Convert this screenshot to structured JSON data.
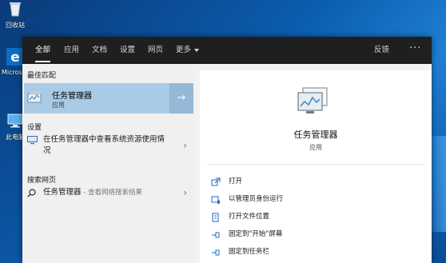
{
  "desktop": {
    "icons": [
      {
        "name": "recycle-bin",
        "label": "回收站"
      },
      {
        "name": "edge",
        "label": "Microsoft Edge"
      },
      {
        "name": "this-pc",
        "label": "此电脑"
      }
    ]
  },
  "search": {
    "tabs": [
      {
        "label": "全部",
        "active": true
      },
      {
        "label": "应用"
      },
      {
        "label": "文档"
      },
      {
        "label": "设置"
      },
      {
        "label": "网页"
      },
      {
        "label": "更多"
      }
    ],
    "feedback": "反馈",
    "more_dots": "···",
    "best_match": {
      "heading": "最佳匹配",
      "title": "任务管理器",
      "subtitle": "应用"
    },
    "settings": {
      "heading": "设置",
      "item": "在任务管理器中查看系统资源使用情况"
    },
    "web": {
      "heading": "搜索网页",
      "query": "任务管理器",
      "suffix": " - 查看网络搜索结果"
    },
    "preview": {
      "title": "任务管理器",
      "subtitle": "应用",
      "actions": [
        {
          "icon": "open-icon",
          "label": "打开"
        },
        {
          "icon": "run-as-admin-icon",
          "label": "以管理员身份运行"
        },
        {
          "icon": "file-location-icon",
          "label": "打开文件位置"
        },
        {
          "icon": "pin-to-start-icon",
          "label": "固定到\"开始\"屏幕"
        },
        {
          "icon": "pin-to-taskbar-icon",
          "label": "固定到任务栏"
        }
      ]
    }
  },
  "colors": {
    "topbar": "#1f1f1f",
    "selected": "#aacbe6",
    "accent": "#0b5cae"
  }
}
